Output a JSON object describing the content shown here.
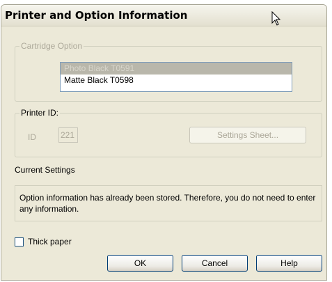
{
  "window": {
    "title": "Printer and Option Information"
  },
  "cartridge_option": {
    "legend": "Cartridge Option",
    "items": [
      {
        "label": "Photo Black T0591",
        "selected": true
      },
      {
        "label": "Matte Black T0598",
        "selected": false
      }
    ]
  },
  "printer_id": {
    "legend": "Printer ID:",
    "id_label": "ID",
    "id_value": "221",
    "settings_button": "Settings Sheet..."
  },
  "current_settings": {
    "heading": "Current Settings",
    "message": "Option information has already been stored. Therefore, you do not need to enter any information."
  },
  "options": {
    "thick_paper_label": "Thick paper",
    "thick_paper_checked": false
  },
  "buttons": {
    "ok": "OK",
    "cancel": "Cancel",
    "help": "Help"
  },
  "colors": {
    "dialog_bg": "#ece9d8",
    "disabled_text": "#aca899",
    "border_blue": "#003c74"
  }
}
